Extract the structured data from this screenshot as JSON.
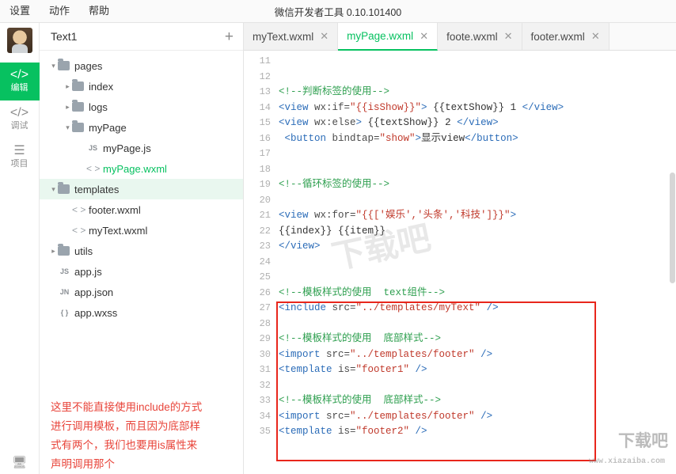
{
  "menubar": {
    "items": [
      "设置",
      "动作",
      "帮助"
    ],
    "title": "微信开发者工具 0.10.101400"
  },
  "activitybar": {
    "items": [
      {
        "icon": "code-brackets-icon",
        "label": "编辑",
        "active": true
      },
      {
        "icon": "debug-icon",
        "label": "调试",
        "active": false
      },
      {
        "icon": "menu-icon",
        "label": "项目",
        "active": false
      }
    ],
    "bottom_icon": "device-icon"
  },
  "filepanel": {
    "title": "Text1",
    "add_label": "+",
    "tree": [
      {
        "depth": 0,
        "arrow": "▾",
        "type": "folder",
        "label": "pages",
        "selected": false,
        "active": false
      },
      {
        "depth": 1,
        "arrow": "▸",
        "type": "folder",
        "label": "index",
        "selected": false,
        "active": false
      },
      {
        "depth": 1,
        "arrow": "▸",
        "type": "folder",
        "label": "logs",
        "selected": false,
        "active": false
      },
      {
        "depth": 1,
        "arrow": "▾",
        "type": "folder",
        "label": "myPage",
        "selected": false,
        "active": false
      },
      {
        "depth": 2,
        "arrow": "",
        "type": "js",
        "label": "myPage.js",
        "selected": false,
        "active": false
      },
      {
        "depth": 2,
        "arrow": "",
        "type": "xml",
        "label": "myPage.wxml",
        "selected": false,
        "active": true
      },
      {
        "depth": 0,
        "arrow": "▾",
        "type": "folder",
        "label": "templates",
        "selected": true,
        "active": false
      },
      {
        "depth": 1,
        "arrow": "",
        "type": "xml",
        "label": "footer.wxml",
        "selected": false,
        "active": false
      },
      {
        "depth": 1,
        "arrow": "",
        "type": "xml",
        "label": "myText.wxml",
        "selected": false,
        "active": false
      },
      {
        "depth": 0,
        "arrow": "▸",
        "type": "folder",
        "label": "utils",
        "selected": false,
        "active": false
      },
      {
        "depth": 0,
        "arrow": "",
        "type": "js",
        "label": "app.js",
        "selected": false,
        "active": false
      },
      {
        "depth": 0,
        "arrow": "",
        "type": "json",
        "label": "app.json",
        "selected": false,
        "active": false
      },
      {
        "depth": 0,
        "arrow": "",
        "type": "wxss",
        "label": "app.wxss",
        "selected": false,
        "active": false
      }
    ],
    "note": "这里不能直接使用include的方式\n进行调用模板，而且因为底部样\n式有两个，我们也要用is属性来\n声明调用那个"
  },
  "tabs": [
    {
      "label": "myText.wxml",
      "active": false,
      "close": "✕"
    },
    {
      "label": "myPage.wxml",
      "active": true,
      "close": "✕"
    },
    {
      "label": "foote.wxml",
      "active": false,
      "close": "✕"
    },
    {
      "label": "footer.wxml",
      "active": false,
      "close": "✕"
    }
  ],
  "code": {
    "first_line_number": 11,
    "lines": [
      {
        "n": 11,
        "segments": []
      },
      {
        "n": 12,
        "segments": []
      },
      {
        "n": 13,
        "segments": [
          {
            "t": "<!--判断标签的使用-->",
            "c": "cmt"
          }
        ]
      },
      {
        "n": 14,
        "segments": [
          {
            "t": "<view ",
            "c": "tag"
          },
          {
            "t": "wx:if=",
            "c": "attr"
          },
          {
            "t": "\"{{isShow}}\"",
            "c": "str"
          },
          {
            "t": ">",
            "c": "tag"
          },
          {
            "t": " {{textShow}} 1 ",
            "c": "plain"
          },
          {
            "t": "</view>",
            "c": "tag"
          }
        ]
      },
      {
        "n": 15,
        "segments": [
          {
            "t": "<view ",
            "c": "tag"
          },
          {
            "t": "wx:else",
            "c": "attr"
          },
          {
            "t": ">",
            "c": "tag"
          },
          {
            "t": " {{textShow}} 2 ",
            "c": "plain"
          },
          {
            "t": "</view>",
            "c": "tag"
          }
        ]
      },
      {
        "n": 16,
        "segments": [
          {
            "t": " <button ",
            "c": "tag"
          },
          {
            "t": "bindtap=",
            "c": "attr"
          },
          {
            "t": "\"show\"",
            "c": "str"
          },
          {
            "t": ">",
            "c": "tag"
          },
          {
            "t": "显示view",
            "c": "plain"
          },
          {
            "t": "</button>",
            "c": "tag"
          }
        ]
      },
      {
        "n": 17,
        "segments": []
      },
      {
        "n": 18,
        "segments": []
      },
      {
        "n": 19,
        "segments": [
          {
            "t": "<!--循环标签的使用-->",
            "c": "cmt"
          }
        ]
      },
      {
        "n": 20,
        "segments": []
      },
      {
        "n": 21,
        "segments": [
          {
            "t": "<view ",
            "c": "tag"
          },
          {
            "t": "wx:for=",
            "c": "attr"
          },
          {
            "t": "\"{{['娱乐','头条','科技']}}\"",
            "c": "str"
          },
          {
            "t": ">",
            "c": "tag"
          }
        ]
      },
      {
        "n": 22,
        "segments": [
          {
            "t": "{{index}} {{item}}",
            "c": "plain"
          }
        ]
      },
      {
        "n": 23,
        "segments": [
          {
            "t": "</view>",
            "c": "tag"
          }
        ]
      },
      {
        "n": 24,
        "segments": []
      },
      {
        "n": 25,
        "segments": []
      },
      {
        "n": 26,
        "segments": [
          {
            "t": "<!--模板样式的使用  text组件-->",
            "c": "cmt"
          }
        ]
      },
      {
        "n": 27,
        "segments": [
          {
            "t": "<include ",
            "c": "tag"
          },
          {
            "t": "src=",
            "c": "attr"
          },
          {
            "t": "\"../templates/myText\"",
            "c": "str"
          },
          {
            "t": " />",
            "c": "tag"
          }
        ]
      },
      {
        "n": 28,
        "segments": []
      },
      {
        "n": 29,
        "segments": [
          {
            "t": "<!--模板样式的使用  底部样式-->",
            "c": "cmt"
          }
        ]
      },
      {
        "n": 30,
        "segments": [
          {
            "t": "<import ",
            "c": "tag"
          },
          {
            "t": "src=",
            "c": "attr"
          },
          {
            "t": "\"../templates/footer\"",
            "c": "str"
          },
          {
            "t": " />",
            "c": "tag"
          }
        ]
      },
      {
        "n": 31,
        "segments": [
          {
            "t": "<template ",
            "c": "tag"
          },
          {
            "t": "is=",
            "c": "attr"
          },
          {
            "t": "\"footer1\"",
            "c": "str"
          },
          {
            "t": " />",
            "c": "tag"
          }
        ]
      },
      {
        "n": 32,
        "segments": []
      },
      {
        "n": 33,
        "segments": [
          {
            "t": "<!--模板样式的使用  底部样式-->",
            "c": "cmt"
          }
        ]
      },
      {
        "n": 34,
        "segments": [
          {
            "t": "<import ",
            "c": "tag"
          },
          {
            "t": "src=",
            "c": "attr"
          },
          {
            "t": "\"../templates/footer\"",
            "c": "str"
          },
          {
            "t": " />",
            "c": "tag"
          }
        ]
      },
      {
        "n": 35,
        "segments": [
          {
            "t": "<template ",
            "c": "tag"
          },
          {
            "t": "is=",
            "c": "attr"
          },
          {
            "t": "\"footer2\"",
            "c": "str"
          },
          {
            "t": " />",
            "c": "tag"
          }
        ]
      }
    ]
  },
  "watermarks": {
    "center": "下载吧",
    "corner": "下载吧",
    "corner_url": "www.xiazaiba.com"
  },
  "colors": {
    "accent": "#07c160",
    "note": "#e8443a",
    "highlight_box": "#e8261c"
  }
}
